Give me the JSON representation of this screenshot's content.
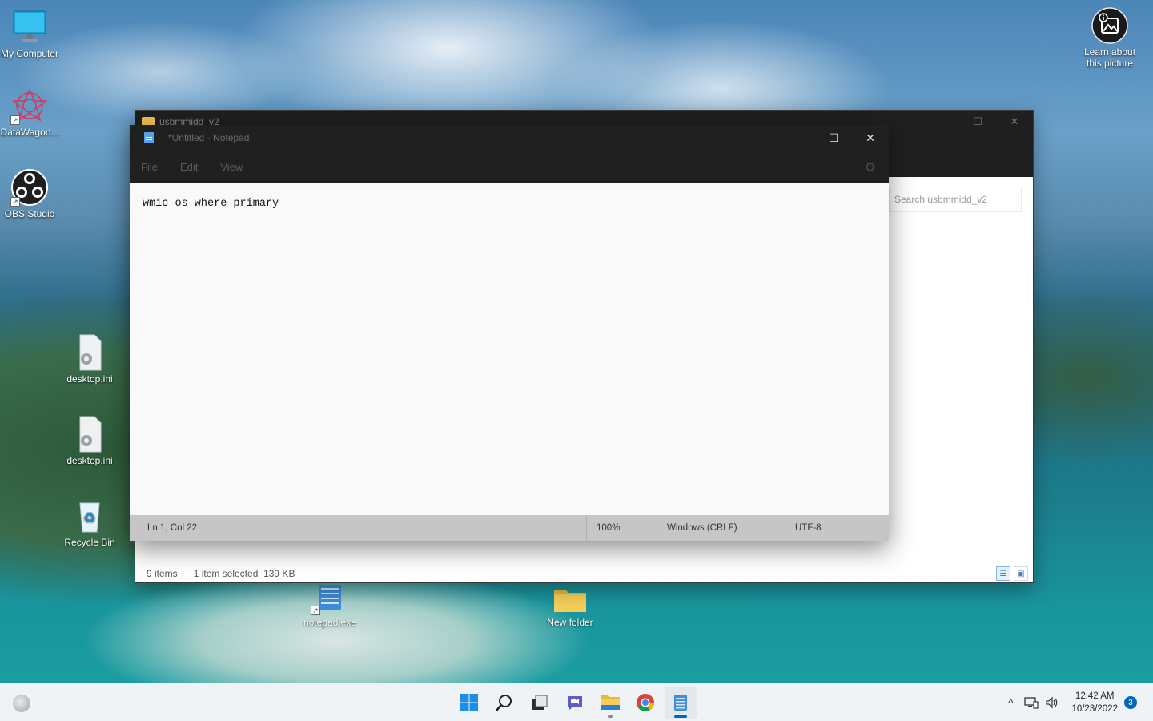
{
  "desktop": {
    "icons": [
      {
        "label": "My Computer",
        "icon": "monitor-icon"
      },
      {
        "label": "DataWagon...",
        "icon": "datawagon-icon"
      },
      {
        "label": "OBS Studio",
        "icon": "obs-icon"
      },
      {
        "label": "desktop.ini",
        "icon": "settings-file-icon"
      },
      {
        "label": "desktop.ini",
        "icon": "settings-file-icon"
      },
      {
        "label": "Recycle Bin",
        "icon": "recycle-bin-icon"
      },
      {
        "label": "notepad.exe",
        "icon": "notepad-icon"
      },
      {
        "label": "New folder",
        "icon": "folder-icon"
      },
      {
        "label": "Learn about this picture",
        "icon": "picture-info-icon"
      }
    ]
  },
  "explorer": {
    "title": "usbmmidd_v2",
    "search_placeholder": "Search usbmmidd_v2",
    "status_items": "9 items",
    "status_selected": "1 item selected",
    "status_size": "139 KB",
    "controls": {
      "minimize": "—",
      "maximize": "☐",
      "close": "✕"
    }
  },
  "notepad": {
    "title": "*Untitled - Notepad",
    "menu": [
      "File",
      "Edit",
      "View"
    ],
    "content": "wmic os where primary",
    "controls": {
      "minimize": "—",
      "maximize": "☐",
      "close": "✕"
    },
    "status": {
      "position": "Ln 1, Col 22",
      "zoom": "100%",
      "line_ending": "Windows (CRLF)",
      "encoding": "UTF-8"
    }
  },
  "taskbar": {
    "apps": [
      "start-icon",
      "search-icon",
      "task-view-icon",
      "chat-icon",
      "file-explorer-icon",
      "chrome-icon",
      "notepad-icon"
    ],
    "tray": {
      "chevron": "^",
      "time": "12:42 AM",
      "date": "10/23/2022",
      "notifications": "3"
    }
  },
  "colors": {
    "accent": "#0067c0",
    "notepad_titlebar": "#202020",
    "statusbar": "#c6c6c6"
  }
}
